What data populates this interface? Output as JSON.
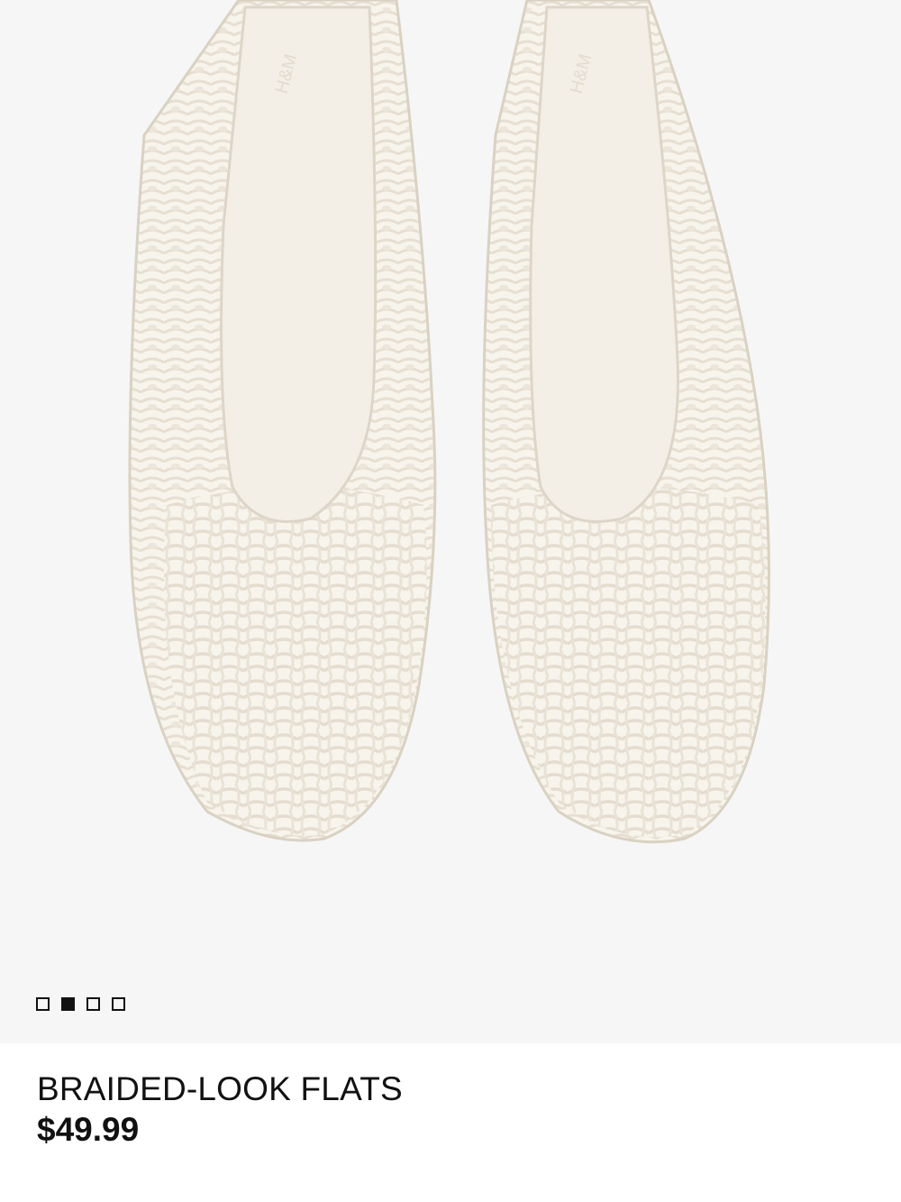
{
  "product": {
    "name": "BRAIDED-LOOK FLATS",
    "price": "$49.99",
    "image_description_icon": "shoe-image"
  },
  "gallery": {
    "total_images": 4,
    "active_index": 1
  },
  "colors": {
    "image_background": "#f6f6f6",
    "shoe_white": "#f4f1e8",
    "shoe_shadow": "#e3ddd0",
    "insole": "#f2eee6",
    "text": "#111111"
  }
}
